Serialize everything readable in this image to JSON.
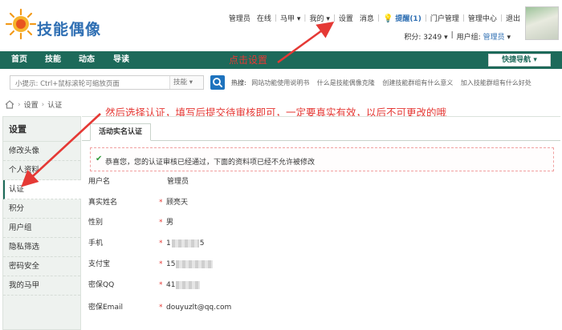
{
  "logo": {
    "text": "技能偶像"
  },
  "topbar": {
    "admin": "管理员",
    "online": "在线",
    "majia": "马甲",
    "mine": "我的",
    "settings": "设置",
    "messages": "消息",
    "remind": "提醒(1)",
    "portal_mgmt": "门户管理",
    "admin_center": "管理中心",
    "logout": "退出",
    "points": "积分: 3249",
    "usergroup_label": "用户组:",
    "usergroup_value": "管理员"
  },
  "navbar": {
    "items": [
      "首页",
      "技能",
      "动态",
      "导读"
    ],
    "quick_nav": "快捷导航",
    "annotation": "点击设置"
  },
  "search": {
    "placeholder": "小提示: Ctrl+鼠标滚轮可缩放页面",
    "scope": "技能",
    "hot_label": "热搜:",
    "hot_words": [
      "网站功能使用说明书",
      "什么是技能偶像克隆",
      "创建技能群组有什么意义",
      "加入技能群组有什么好处"
    ]
  },
  "breadcrumb": {
    "level1": "设置",
    "level2": "认证"
  },
  "instruction": "然后选择认证，填写后提交待审核即可，一定要真实有效，以后不可更改的哦",
  "sidebar": {
    "title": "设置",
    "items": [
      "修改头像",
      "个人资料",
      "认证",
      "积分",
      "用户组",
      "隐私筛选",
      "密码安全",
      "我的马甲"
    ]
  },
  "content": {
    "tab": "活动实名认证",
    "notice": "恭喜您，您的认证审核已经通过，下面的资料项已经不允许被修改",
    "fields": [
      {
        "label": "用户名",
        "value": "管理员",
        "required": false
      },
      {
        "label": "真实姓名",
        "value": "顾亮天",
        "required": true
      },
      {
        "label": "性别",
        "value": "男",
        "required": true
      },
      {
        "label": "手机",
        "value_prefix": "1",
        "value_suffix": "5",
        "required": true
      },
      {
        "label": "支付宝",
        "value_prefix": "15",
        "value_suffix": "",
        "required": true
      },
      {
        "label": "密保QQ",
        "value_prefix": "41",
        "value_suffix": "",
        "required": true
      },
      {
        "label": "密保Email",
        "value": "douyuzlt@qq.com",
        "required": true
      }
    ]
  },
  "colors": {
    "brand": "#1d6a5a",
    "link": "#2f6fb3",
    "annotation": "#e53935",
    "required": "#e53935"
  },
  "icons": [
    "sun-logo-icon",
    "bulb-icon",
    "search-icon",
    "home-icon",
    "check-icon",
    "chevron-down-icon"
  ]
}
